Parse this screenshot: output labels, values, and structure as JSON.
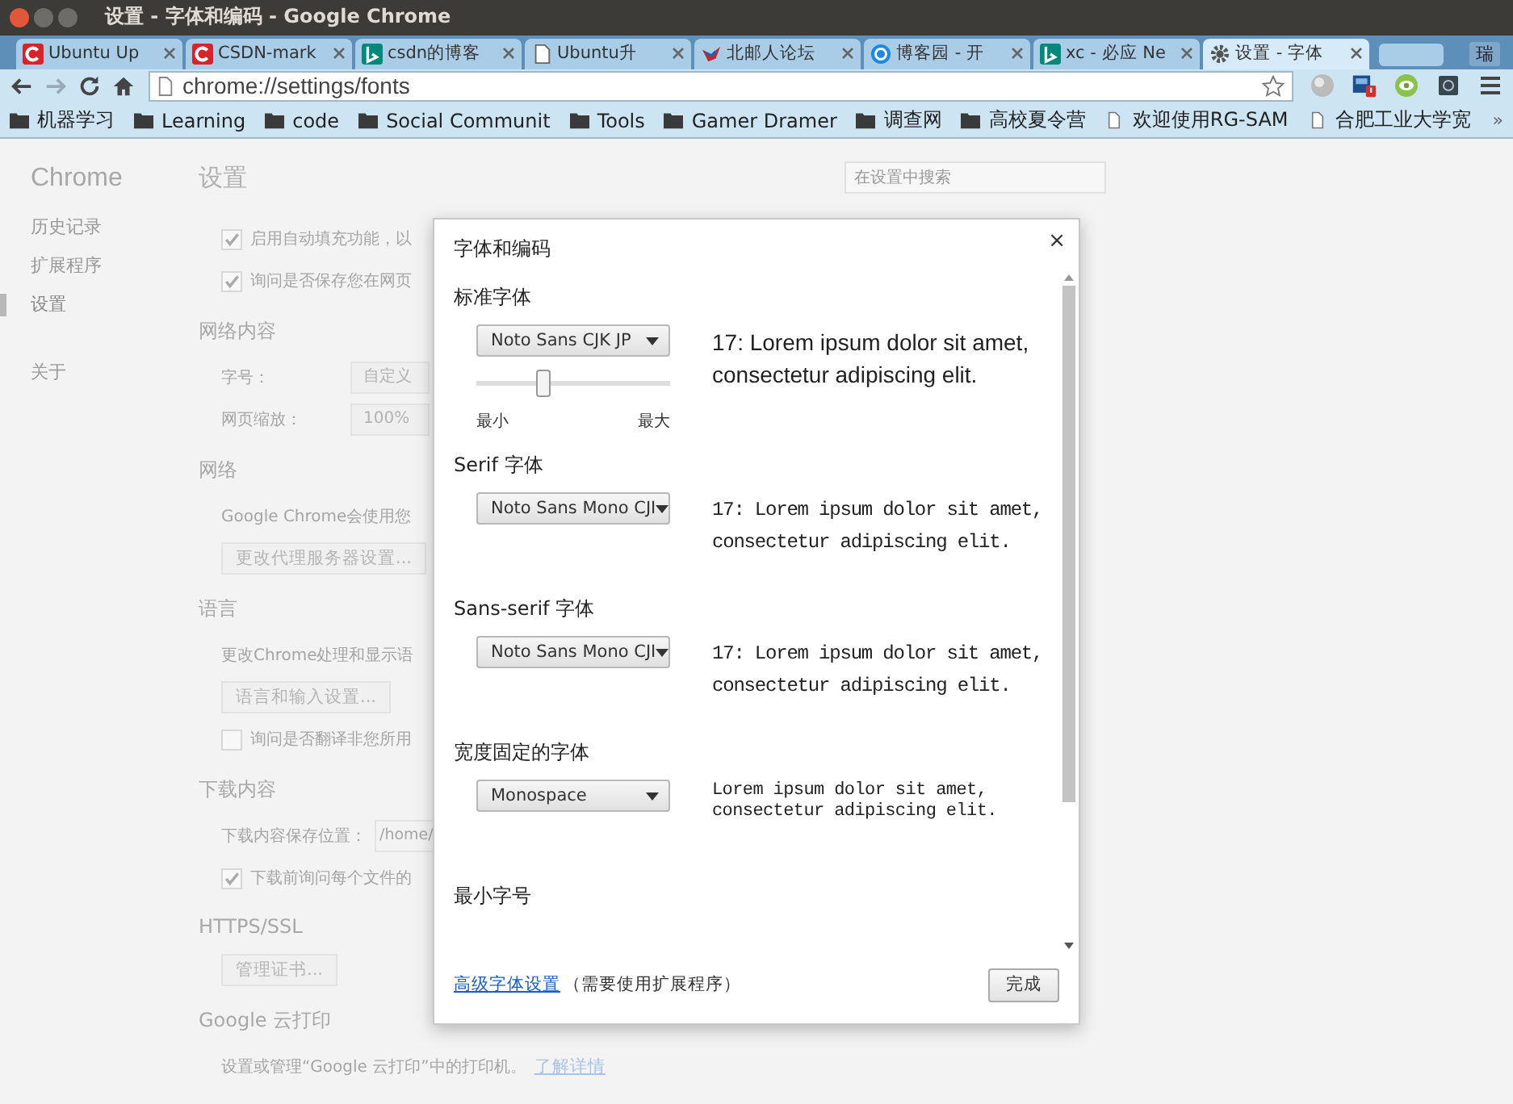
{
  "window": {
    "title": "设置 - 字体和编码 - Google Chrome"
  },
  "tabs": [
    {
      "label": "Ubuntu Up",
      "kind": "csdn",
      "selected": false
    },
    {
      "label": "CSDN-mark",
      "kind": "csdn",
      "selected": false
    },
    {
      "label": "csdn的博客",
      "kind": "bing",
      "selected": false
    },
    {
      "label": "Ubuntu升",
      "kind": "page",
      "selected": false
    },
    {
      "label": "北邮人论坛",
      "kind": "bird",
      "selected": false
    },
    {
      "label": "博客园 - 开",
      "kind": "circle",
      "selected": false
    },
    {
      "label": "xc - 必应 Ne",
      "kind": "bing",
      "selected": false
    },
    {
      "label": "设置 - 字体",
      "kind": "gear",
      "selected": true
    }
  ],
  "profile": "瑞",
  "address": {
    "url": "chrome://settings/fonts"
  },
  "bookmarks": [
    {
      "label": "机器学习",
      "kind": "folder"
    },
    {
      "label": "Learning",
      "kind": "folder"
    },
    {
      "label": "code",
      "kind": "folder"
    },
    {
      "label": "Social Communit",
      "kind": "folder"
    },
    {
      "label": "Tools",
      "kind": "folder"
    },
    {
      "label": "Gamer Dramer",
      "kind": "folder"
    },
    {
      "label": "调查网",
      "kind": "folder"
    },
    {
      "label": "高校夏令营",
      "kind": "folder"
    },
    {
      "label": "欢迎使用RG-SAM",
      "kind": "page"
    },
    {
      "label": "合肥工业大学宽",
      "kind": "page"
    }
  ],
  "bookmarks_more": "»",
  "sidebar": {
    "title": "Chrome",
    "items": [
      {
        "label": "历史记录",
        "selected": false
      },
      {
        "label": "扩展程序",
        "selected": false
      },
      {
        "label": "设置",
        "selected": true
      }
    ],
    "about": {
      "label": "关于",
      "selected": false
    }
  },
  "settings": {
    "title": "设置",
    "search_placeholder": "在设置中搜索",
    "sections": [
      {
        "rows": [
          {
            "kind": "checkbox",
            "label": "启用自动填充功能，以",
            "checked": true
          },
          {
            "kind": "checkbox",
            "label": "询问是否保存您在网页",
            "checked": true
          }
        ]
      },
      {
        "heading": "网络内容",
        "rows": [
          {
            "kind": "select",
            "label": "字号：",
            "value": "自定义"
          },
          {
            "kind": "select",
            "label": "网页缩放：",
            "value": "100%"
          }
        ]
      },
      {
        "heading": "网络",
        "rows": [
          {
            "kind": "text",
            "label": "Google Chrome会使用您"
          },
          {
            "kind": "button",
            "label": "更改代理服务器设置..."
          }
        ]
      },
      {
        "heading": "语言",
        "rows": [
          {
            "kind": "text",
            "label": "更改Chrome处理和显示语"
          },
          {
            "kind": "button",
            "label": "语言和输入设置..."
          },
          {
            "kind": "checkbox",
            "label": "询问是否翻译非您所用",
            "checked": false
          }
        ]
      },
      {
        "heading": "下载内容",
        "rows": [
          {
            "kind": "path",
            "label": "下载内容保存位置：",
            "value": "/home/"
          },
          {
            "kind": "checkbox",
            "label": "下载前询问每个文件的",
            "checked": true
          }
        ]
      },
      {
        "heading": "HTTPS/SSL",
        "rows": [
          {
            "kind": "button",
            "label": "管理证书..."
          }
        ]
      },
      {
        "heading": "Google 云打印",
        "rows": [
          {
            "kind": "link_text",
            "label": "设置或管理“Google 云打印”中的打印机。",
            "link": "了解详情"
          }
        ]
      }
    ]
  },
  "dialog": {
    "title": "字体和编码",
    "close": "×",
    "sections": [
      {
        "heading": "标准字体",
        "font": "Noto Sans CJK JP",
        "sample": "17: Lorem ipsum dolor sit amet, consectetur adipiscing elit.",
        "kind": "sans",
        "slider": {
          "level": 0.35,
          "min_label": "最小",
          "max_label": "最大"
        }
      },
      {
        "heading": "Serif 字体",
        "font": "Noto Sans Mono CJI",
        "sample": "17: Lorem ipsum dolor sit amet, consectetur adipiscing elit.",
        "kind": "mono"
      },
      {
        "heading": "Sans-serif 字体",
        "font": "Noto Sans Mono CJI",
        "sample": "17: Lorem ipsum dolor sit amet, consectetur adipiscing elit.",
        "kind": "mono"
      },
      {
        "heading": "宽度固定的字体",
        "font": "Monospace",
        "sample": "Lorem ipsum dolor sit amet, consectetur adipiscing elit.",
        "kind": "mono-small"
      },
      {
        "heading": "最小字号"
      }
    ],
    "footer": {
      "link": "高级字体设置",
      "note": "（需要使用扩展程序）",
      "button": "完成"
    }
  }
}
